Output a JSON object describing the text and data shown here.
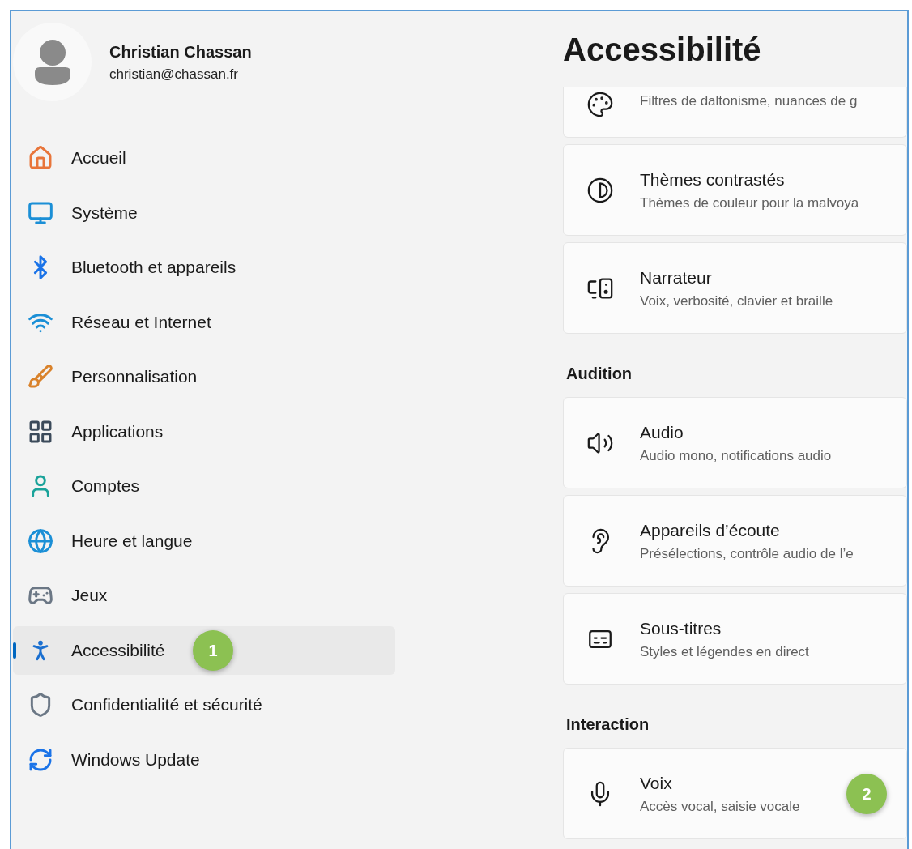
{
  "user": {
    "name": "Christian Chassan",
    "email": "christian@chassan.fr"
  },
  "nav": [
    {
      "label": "Accueil",
      "selected": false
    },
    {
      "label": "Système",
      "selected": false
    },
    {
      "label": "Bluetooth et appareils",
      "selected": false
    },
    {
      "label": "Réseau et Internet",
      "selected": false
    },
    {
      "label": "Personnalisation",
      "selected": false
    },
    {
      "label": "Applications",
      "selected": false
    },
    {
      "label": "Comptes",
      "selected": false
    },
    {
      "label": "Heure et langue",
      "selected": false
    },
    {
      "label": "Jeux",
      "selected": false
    },
    {
      "label": "Accessibilité",
      "selected": true,
      "badge": "1"
    },
    {
      "label": "Confidentialité et sécurité",
      "selected": false
    },
    {
      "label": "Windows Update",
      "selected": false
    }
  ],
  "page_title": "Accessibilité",
  "sections": [
    {
      "cards": [
        {
          "subtitle": "Filtres de daltonisme, nuances de g"
        },
        {
          "title": "Thèmes contrastés",
          "subtitle": "Thèmes de couleur pour la malvoya"
        },
        {
          "title": "Narrateur",
          "subtitle": "Voix, verbosité, clavier et braille"
        }
      ]
    },
    {
      "heading": "Audition",
      "cards": [
        {
          "title": "Audio",
          "subtitle": "Audio mono, notifications audio"
        },
        {
          "title": "Appareils d’écoute",
          "subtitle": "Présélections, contrôle audio de l’e"
        },
        {
          "title": "Sous-titres",
          "subtitle": "Styles et légendes en direct"
        }
      ]
    },
    {
      "heading": "Interaction",
      "cards": [
        {
          "title": "Voix",
          "subtitle": "Accès vocal, saisie vocale",
          "badge": "2"
        }
      ]
    }
  ]
}
